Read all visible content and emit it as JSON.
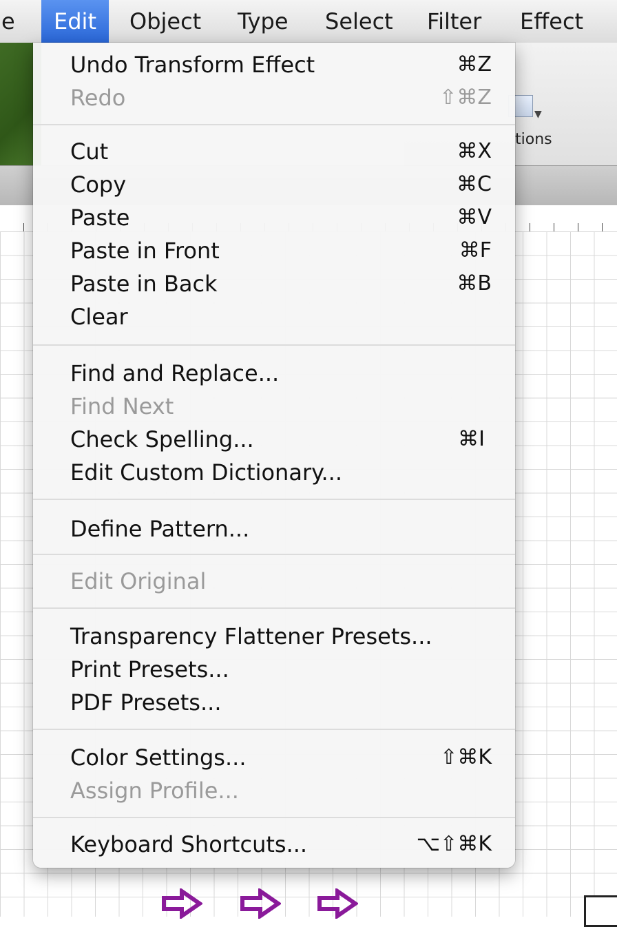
{
  "menubar": {
    "items": [
      "e",
      "Edit",
      "Object",
      "Type",
      "Select",
      "Filter",
      "Effect"
    ]
  },
  "background": {
    "panel_label": "tions"
  },
  "menu": {
    "items": [
      {
        "label": "Undo Transform Effect",
        "shortcut": "⌘Z",
        "enabled": true
      },
      {
        "label": "Redo",
        "shortcut": "⇧⌘Z",
        "enabled": false
      },
      {
        "label": "Cut",
        "shortcut": "⌘X",
        "enabled": true
      },
      {
        "label": "Copy",
        "shortcut": "⌘C",
        "enabled": true
      },
      {
        "label": "Paste",
        "shortcut": "⌘V",
        "enabled": true
      },
      {
        "label": "Paste in Front",
        "shortcut": "⌘F",
        "enabled": true
      },
      {
        "label": "Paste in Back",
        "shortcut": "⌘B",
        "enabled": true
      },
      {
        "label": "Clear",
        "shortcut": "",
        "enabled": true
      },
      {
        "label": "Find and Replace...",
        "shortcut": "",
        "enabled": true
      },
      {
        "label": "Find Next",
        "shortcut": "",
        "enabled": false
      },
      {
        "label": "Check Spelling...",
        "shortcut": "⌘I",
        "enabled": true
      },
      {
        "label": "Edit Custom Dictionary...",
        "shortcut": "",
        "enabled": true
      },
      {
        "label": "Define Pattern...",
        "shortcut": "",
        "enabled": true
      },
      {
        "label": "Edit Original",
        "shortcut": "",
        "enabled": false
      },
      {
        "label": "Transparency Flattener Presets...",
        "shortcut": "",
        "enabled": true
      },
      {
        "label": "Print Presets...",
        "shortcut": "",
        "enabled": true
      },
      {
        "label": "PDF Presets...",
        "shortcut": "",
        "enabled": true
      },
      {
        "label": "Color Settings...",
        "shortcut": "⇧⌘K",
        "enabled": true
      },
      {
        "label": "Assign Profile...",
        "shortcut": "",
        "enabled": false
      },
      {
        "label": "Keyboard Shortcuts...",
        "shortcut": "⌥⇧⌘K",
        "enabled": true
      }
    ]
  },
  "colors": {
    "menu_highlight": "#2a67d8",
    "disabled_text": "#9a9a9a",
    "arrow": "#8a1a9a"
  }
}
